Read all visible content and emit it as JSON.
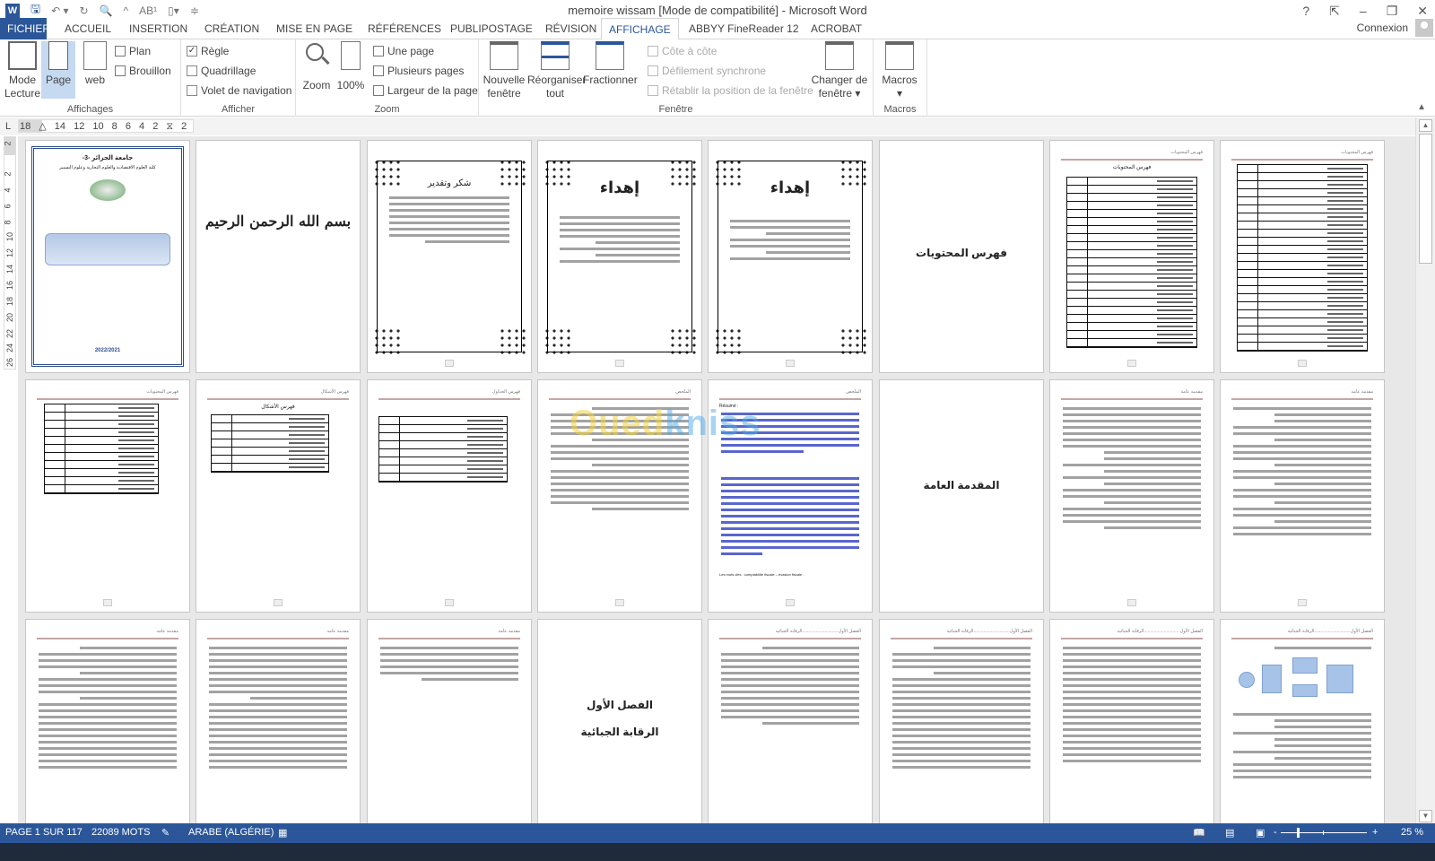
{
  "window": {
    "title": "memoire wissam [Mode de compatibilité] - Microsoft Word",
    "controls": [
      "?",
      "⇱",
      "–",
      "❐",
      "✕"
    ]
  },
  "qat": {
    "icons": [
      "word-logo",
      "save-icon",
      "undo-icon",
      "redo-icon",
      "print-preview-icon",
      "font-up-icon",
      "spelling-icon",
      "new-doc-icon",
      "customize-icon"
    ]
  },
  "tabs": [
    {
      "label": "FICHIER",
      "active": false
    },
    {
      "label": "ACCUEIL",
      "active": false
    },
    {
      "label": "INSERTION",
      "active": false
    },
    {
      "label": "CRÉATION",
      "active": false
    },
    {
      "label": "MISE EN PAGE",
      "active": false
    },
    {
      "label": "RÉFÉRENCES",
      "active": false
    },
    {
      "label": "PUBLIPOSTAGE",
      "active": false
    },
    {
      "label": "RÉVISION",
      "active": false
    },
    {
      "label": "AFFICHAGE",
      "active": true
    },
    {
      "label": "ABBYY FineReader 12",
      "active": false
    },
    {
      "label": "ACROBAT",
      "active": false
    }
  ],
  "account": {
    "label": "Connexion"
  },
  "ribbon": {
    "affichages": {
      "label": "Affichages",
      "mode_lecture": "Mode Lecture",
      "mode_lecture_l1": "Mode",
      "mode_lecture_l2": "Lecture",
      "page": "Page",
      "web": "web",
      "plan": "Plan",
      "brouillon": "Brouillon"
    },
    "afficher": {
      "label": "Afficher",
      "regle": {
        "label": "Règle",
        "checked": true
      },
      "quadrillage": {
        "label": "Quadrillage",
        "checked": false
      },
      "volet": {
        "label": "Volet de navigation",
        "checked": false
      }
    },
    "zoom": {
      "label": "Zoom",
      "zoom": "Zoom",
      "hundred": "100%",
      "une_page": "Une page",
      "plusieurs_pages": "Plusieurs pages",
      "largeur": "Largeur de la page"
    },
    "fenetre": {
      "label": "Fenêtre",
      "nouvelle_l1": "Nouvelle",
      "nouvelle_l2": "fenêtre",
      "reorganiser_l1": "Réorganiser",
      "reorganiser_l2": "tout",
      "fractionner": "Fractionner",
      "cote": "Côte à côte",
      "defilement": "Défilement synchrone",
      "retablir": "Rétablir la position de la fenêtre",
      "changer_l1": "Changer de",
      "changer_l2": "fenêtre ▾"
    },
    "macros": {
      "label": "Macros",
      "macros": "Macros",
      "arrow": "▾"
    }
  },
  "ruler": {
    "corner": "L",
    "numbers": "18 △ 14 12 10 8 6 4 2 ⧖ 2",
    "vertical": [
      "2",
      "2",
      "4",
      "6",
      "8",
      "10",
      "12",
      "14",
      "16",
      "18",
      "20",
      "22",
      "24",
      "26"
    ]
  },
  "pages": {
    "cover": {
      "line1": "جامعة الجزائر -3-",
      "line2": "كلية العلوم الاقتصادية والعلوم التجارية وعلوم التسيير",
      "year": "2022/2021"
    },
    "basmala": "بسم الله الرحمن الرحيم",
    "shukr": "شكر وتقدير",
    "ihdaa": "إهداء",
    "fihris": "فهرس المحتويات",
    "fihris_small": "فهرس المحتويات",
    "fihris_ashkal": "فهرس الأشكال",
    "fihris_jadawil": "فهرس الجداول",
    "mulakhas": "الملخص",
    "resume": "Résumé :",
    "mots_cles": "Les mots clés : comptabilité fiscale – évasion fiscale .",
    "muqaddima": "المقدمة العامة",
    "muqaddima_hdr": "مقدمة عامة",
    "fasl1_l1": "الفصل الأول",
    "fasl1_l2": "الرقابة الجبائية",
    "fasl1_hdr": "الفصل الأول.............................الرقابة الجبائية"
  },
  "watermark": {
    "a": "Oued",
    "b": "kniss"
  },
  "status": {
    "page": "PAGE 1 SUR 117",
    "words": "22089 MOTS",
    "language": "ARABE (ALGÉRIE)",
    "zoom": "25 %",
    "zoom_minus": "-",
    "zoom_plus": "+",
    "zoom_value": 0.25
  }
}
